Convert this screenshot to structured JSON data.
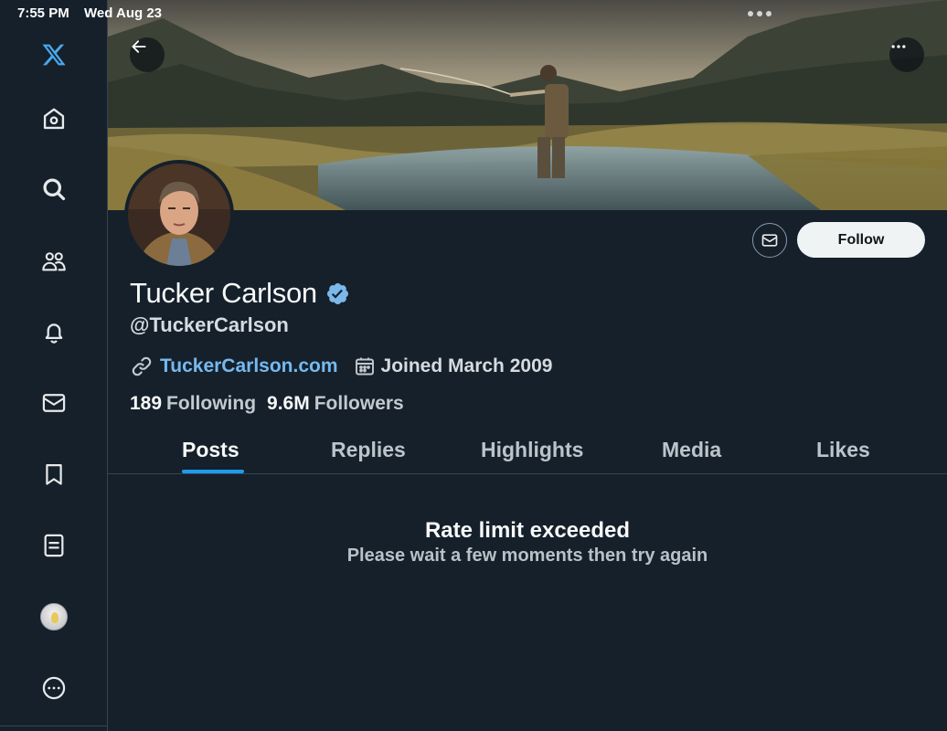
{
  "status_bar": {
    "time": "7:55 PM",
    "date": "Wed Aug 23"
  },
  "sidebar": {
    "items": [
      {
        "name": "x-logo-icon"
      },
      {
        "name": "home-icon"
      },
      {
        "name": "search-icon"
      },
      {
        "name": "communities-icon"
      },
      {
        "name": "notifications-bell-icon"
      },
      {
        "name": "messages-envelope-icon"
      },
      {
        "name": "bookmark-icon"
      },
      {
        "name": "lists-icon"
      },
      {
        "name": "profile-avatar"
      },
      {
        "name": "more-options-icon"
      }
    ]
  },
  "profile": {
    "display_name": "Tucker Carlson",
    "verified": true,
    "handle": "@TuckerCarlson",
    "website": "TuckerCarlson.com",
    "joined": "Joined March 2009",
    "following_count": "189",
    "following_label": "Following",
    "followers_count": "9.6M",
    "followers_label": "Followers",
    "follow_label": "Follow"
  },
  "tabs": [
    {
      "label": "Posts",
      "active": true
    },
    {
      "label": "Replies",
      "active": false
    },
    {
      "label": "Highlights",
      "active": false
    },
    {
      "label": "Media",
      "active": false
    },
    {
      "label": "Likes",
      "active": false
    }
  ],
  "error": {
    "title": "Rate limit exceeded",
    "message": "Please wait a few moments then try again"
  },
  "colors": {
    "background": "#15202b",
    "accent": "#1d9bf0",
    "link": "#76b9ef",
    "logo": "#1d9bf0"
  }
}
